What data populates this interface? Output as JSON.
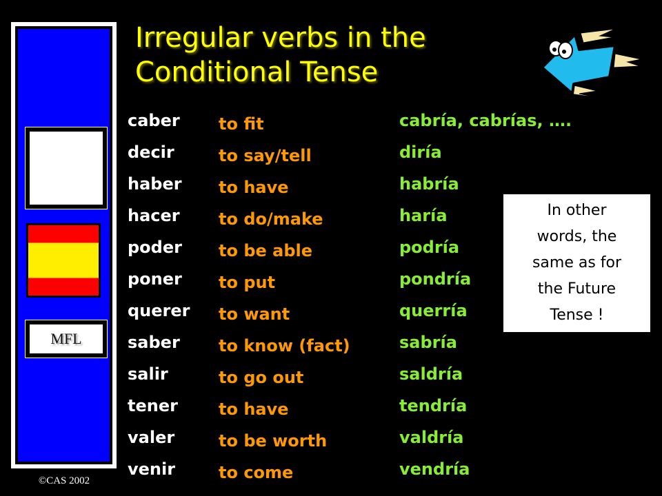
{
  "slide": {
    "title_line1": "Irregular verbs in the",
    "title_line2": "Conditional Tense",
    "colors": {
      "background": "#000000",
      "title": "#ffff00",
      "infinitive": "#ffffff",
      "meaning": "#ff9900",
      "conditional": "#88ee33",
      "sidebar": "#0000ff"
    }
  },
  "sidebar": {
    "badge_label": "MFL",
    "flag_icon": "spain-flag-icon",
    "copyright": "©CAS 2002"
  },
  "decoration": {
    "icon": "flying-arrow-icon"
  },
  "verbs": [
    {
      "infinitive": "caber",
      "meaning": "to fit",
      "conditional": "cabría, cabrías, …."
    },
    {
      "infinitive": "decir",
      "meaning": "to say/tell",
      "conditional": "diría"
    },
    {
      "infinitive": "haber",
      "meaning": "to have",
      "conditional": "habría"
    },
    {
      "infinitive": "hacer",
      "meaning": "to do/make",
      "conditional": "haría"
    },
    {
      "infinitive": "poder",
      "meaning": "to be able",
      "conditional": "podría"
    },
    {
      "infinitive": "poner",
      "meaning": "to put",
      "conditional": "pondría"
    },
    {
      "infinitive": "querer",
      "meaning": "to want",
      "conditional": "querría"
    },
    {
      "infinitive": "saber",
      "meaning": "to know (fact)",
      "conditional": "sabría"
    },
    {
      "infinitive": "salir",
      "meaning": "to go out",
      "conditional": "saldría"
    },
    {
      "infinitive": "tener",
      "meaning": "to have",
      "conditional": "tendría"
    },
    {
      "infinitive": "valer",
      "meaning": "to be worth",
      "conditional": "valdría"
    },
    {
      "infinitive": "venir",
      "meaning": "to come",
      "conditional": "vendría"
    }
  ],
  "note": {
    "lines": [
      "In other",
      "words, the",
      "same as for",
      "the Future",
      "Tense !"
    ]
  }
}
